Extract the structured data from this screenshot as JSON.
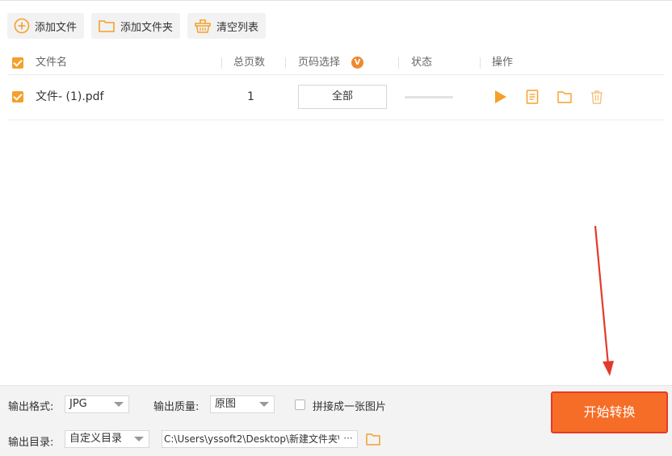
{
  "toolbar": {
    "add_file": "添加文件",
    "add_folder": "添加文件夹",
    "clear_list": "清空列表"
  },
  "table": {
    "headers": {
      "name": "文件名",
      "pages": "总页数",
      "page_select": "页码选择",
      "page_select_badge": "V",
      "status": "状态",
      "actions": "操作"
    },
    "rows": [
      {
        "checked": true,
        "name": "文件- (1).pdf",
        "pages": "1",
        "page_select": "全部",
        "progress": 0
      }
    ]
  },
  "bottom": {
    "format_label": "输出格式:",
    "format_value": "JPG",
    "quality_label": "输出质量:",
    "quality_value": "原图",
    "merge_label": "拼接成一张图片",
    "merge_checked": false,
    "dir_label": "输出目录:",
    "dir_mode": "自定义目录",
    "dir_path": "C:\\Users\\yssoft2\\Desktop\\新建文件夹\\",
    "dir_more": "···"
  },
  "start_button": "开始转换",
  "colors": {
    "accent": "#f5a02b",
    "start_button": "#f66d27",
    "highlight_red": "#e53b28"
  },
  "icons": [
    "plus-circle-icon",
    "folder-icon",
    "basket-icon",
    "checkbox-icon",
    "play-icon",
    "document-icon",
    "folder-icon",
    "trash-icon"
  ]
}
